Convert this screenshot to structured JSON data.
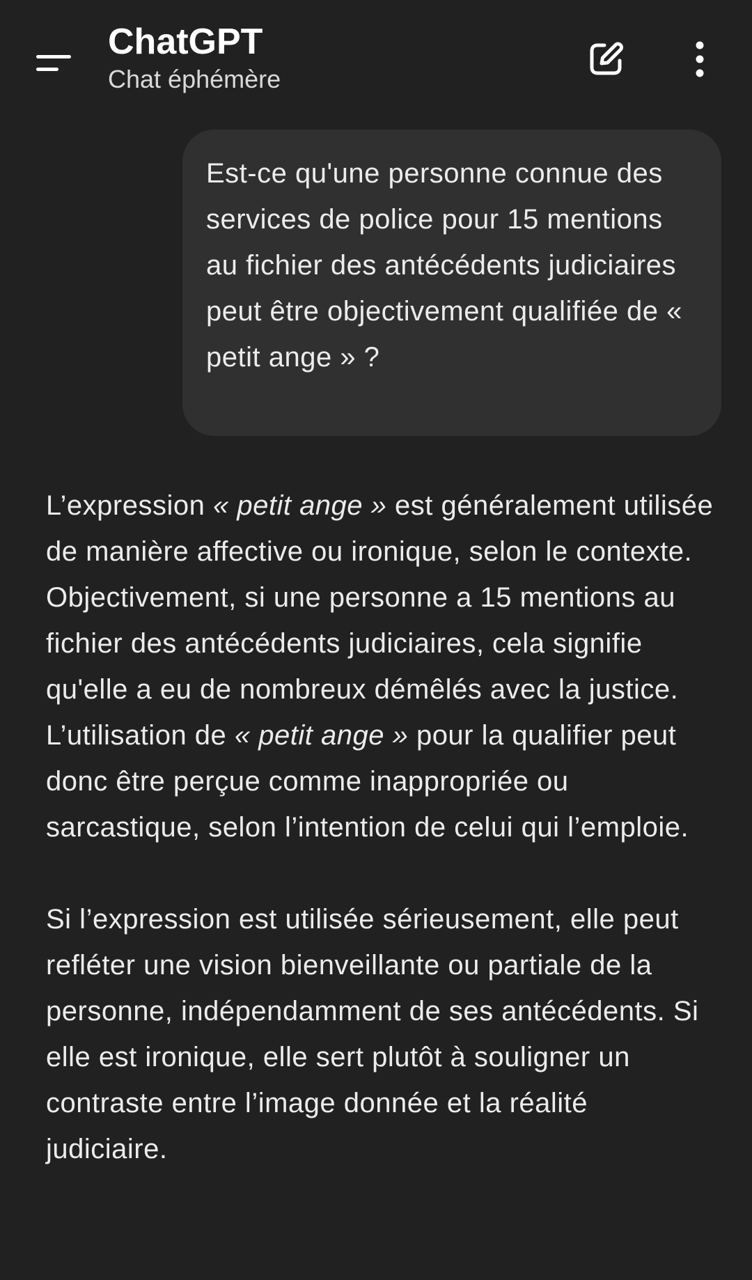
{
  "header": {
    "title": "ChatGPT",
    "subtitle": "Chat éphémère",
    "icons": {
      "menu": "menu-icon",
      "new_chat": "edit-icon",
      "more": "more-vertical-icon"
    }
  },
  "messages": {
    "user": {
      "text": "Est-ce qu'une personne connue des services de police pour 15 mentions au fichier des antécédents judiciaires peut être objectivement qualifiée de « petit ange » ?"
    },
    "assistant": {
      "p1": {
        "a": "L’expression ",
        "b": "« petit ange »",
        "c": " est généralement utilisée de manière affective ou ironique, selon le contexte. Objectivement, si une personne a 15 mentions au fichier des antécédents judiciaires, cela signifie qu'elle a eu de nombreux démêlés avec la justice. L’utilisation de ",
        "d": "« petit ange »",
        "e": " pour la qualifier peut donc être perçue comme inappropriée ou sarcastique, selon l’intention de celui qui l’emploie."
      },
      "p2": "Si l’expression est utilisée sérieusement, elle peut refléter une vision bienveillante ou partiale de la personne, indépendamment de ses antécédents. Si elle est ironique, elle sert plutôt à souligner un contraste entre l’image donnée et la réalité judiciaire."
    }
  }
}
